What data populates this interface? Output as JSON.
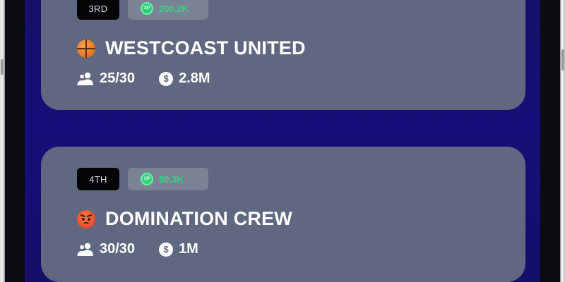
{
  "teams": [
    {
      "rank": "3RD",
      "xp": "200.2K",
      "emoji_icon": "basketball-icon",
      "name": "WESTCOAST UNITED",
      "members": "25/30",
      "funds": "2.8M"
    },
    {
      "rank": "4TH",
      "xp": "50.3K",
      "emoji_icon": "angry-face-icon",
      "name": "DOMINATION CREW",
      "members": "30/30",
      "funds": "1M"
    }
  ],
  "icons": {
    "xp_label": "XP",
    "coin_symbol": "$"
  },
  "colors": {
    "background": "#160f7a",
    "card": "#5f6880",
    "rank_badge": "#050508",
    "xp_badge": "#7a8296",
    "xp_text": "#39d483"
  }
}
